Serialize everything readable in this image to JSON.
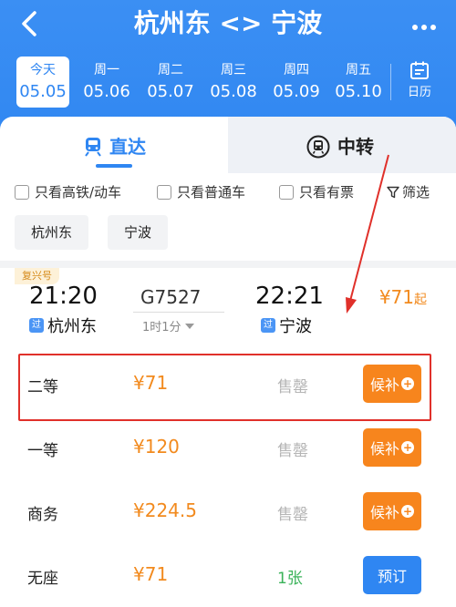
{
  "header": {
    "title": "杭州东 <> 宁波"
  },
  "dates": [
    {
      "weekday": "今天",
      "date": "05.05",
      "selected": true
    },
    {
      "weekday": "周一",
      "date": "05.06"
    },
    {
      "weekday": "周二",
      "date": "05.07"
    },
    {
      "weekday": "周三",
      "date": "05.08"
    },
    {
      "weekday": "周四",
      "date": "05.09"
    },
    {
      "weekday": "周五",
      "date": "05.10"
    }
  ],
  "calendar_label": "日历",
  "tabs": {
    "direct": "直达",
    "transfer": "中转"
  },
  "filters": {
    "high_speed": "只看高铁/动车",
    "normal": "只看普通车",
    "available": "只看有票",
    "filter": "筛选"
  },
  "stations": {
    "from": "杭州东",
    "to": "宁波"
  },
  "train": {
    "badge": "复兴号",
    "depart_time": "21:20",
    "arrive_time": "22:21",
    "number": "G7527",
    "duration": "1时1分",
    "from_station": "杭州东",
    "to_station": "宁波",
    "pass_tag": "过",
    "price_from": "¥71",
    "price_suffix": "起"
  },
  "seats": [
    {
      "name": "二等",
      "price": "¥71",
      "status": "售罄",
      "action": "候补"
    },
    {
      "name": "一等",
      "price": "¥120",
      "status": "售罄",
      "action": "候补"
    },
    {
      "name": "商务",
      "price": "¥224.5",
      "status": "售罄",
      "action": "候补"
    },
    {
      "name": "无座",
      "price": "¥71",
      "status": "1张",
      "action": "预订"
    }
  ],
  "colors": {
    "primary": "#2f86f2",
    "orange": "#f7851d",
    "annotation": "#e0302a"
  }
}
